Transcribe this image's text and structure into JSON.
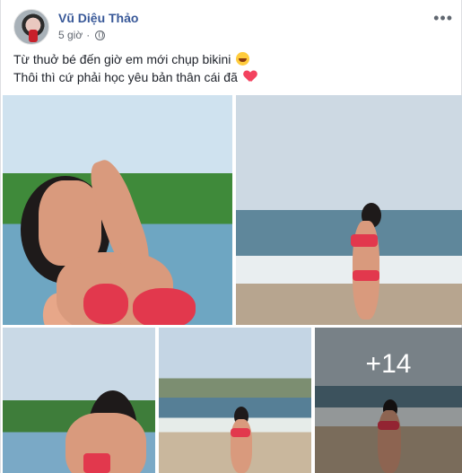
{
  "post": {
    "author": "Vũ Diệu Thảo",
    "timestamp": "5 giờ",
    "privacy_icon": "globe-icon",
    "more_icon": "more-options-icon",
    "text_line1": "Từ thuở bé đến giờ em mới chụp bikini",
    "text_line2": "Thôi thì cứ phải học yêu bản thân cái đã",
    "emoji1": "laughing-face",
    "emoji2": "red-heart"
  },
  "photos": {
    "more_count": "+14"
  },
  "colors": {
    "author_link": "#385898",
    "text": "#1d2129",
    "meta": "#616770",
    "heart": "#f3425f"
  }
}
